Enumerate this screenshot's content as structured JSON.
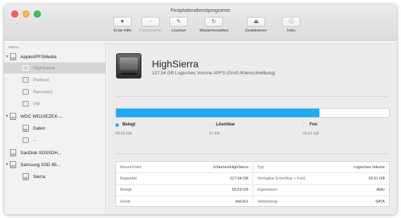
{
  "window": {
    "title": "Festplattendienstprogramm"
  },
  "toolbar": {
    "items": [
      {
        "label": "Erste Hilfe",
        "icon": "stethoscope-icon",
        "glyph": "♥",
        "enabled": true
      },
      {
        "label": "Partitionieren",
        "icon": "partition-pie-icon",
        "glyph": "◔",
        "enabled": false
      },
      {
        "label": "Löschen",
        "icon": "erase-icon",
        "glyph": "✎",
        "enabled": true
      },
      {
        "label": "Wiederherstellen",
        "icon": "restore-icon",
        "glyph": "↻",
        "enabled": true
      },
      {
        "label": "Deaktivieren",
        "icon": "eject-icon",
        "glyph": "⏏",
        "enabled": true
      },
      {
        "label": "Infos",
        "icon": "info-icon",
        "glyph": "ⓘ",
        "enabled": true
      }
    ]
  },
  "sidebar": {
    "section_header": "Intern",
    "items": [
      {
        "label": "AppleAPFSMedia",
        "type": "disk",
        "expanded": true
      },
      {
        "label": "HighSierra",
        "type": "volume",
        "selected": true
      },
      {
        "label": "Preboot",
        "type": "volume",
        "dimmed": true
      },
      {
        "label": "Recovery",
        "type": "volume",
        "dimmed": true
      },
      {
        "label": "VM",
        "type": "volume",
        "dimmed": true
      },
      {
        "label": "WDC WD10EZEX-...",
        "type": "disk",
        "expanded": true
      },
      {
        "label": "Daten",
        "type": "volume",
        "dimmed": false
      },
      {
        "label": "--",
        "type": "volume",
        "dimmed": true
      },
      {
        "label": "SanDisk SDSSDH...",
        "type": "disk",
        "expanded": false
      },
      {
        "label": "Samsung SSD 85...",
        "type": "disk",
        "expanded": true
      },
      {
        "label": "Sierra",
        "type": "volume",
        "dimmed": false
      }
    ]
  },
  "volume": {
    "name": "HighSierra",
    "description": "127,04 GB Logisches Volume APFS (Groß-/Kleinschreibung)"
  },
  "usage": {
    "used_fraction": 0.745,
    "legend": [
      {
        "label": "Belegt",
        "value": "93,53 GB",
        "color": "#1badf8"
      },
      {
        "label": "Löschbar",
        "value": "17 KB",
        "color": "#ffffff"
      },
      {
        "label": "Frei",
        "value": "33,51 GB",
        "color": "#ffffff"
      }
    ]
  },
  "info": {
    "rows": [
      [
        {
          "key": "Mount-Point:",
          "value": "/Volumes/HighSierra"
        },
        {
          "key": "Typ:",
          "value": "Logisches Volume"
        }
      ],
      [
        {
          "key": "Kapazität:",
          "value": "127,04 GB"
        },
        {
          "key": "Verfügbar (Löschbar + Frei):",
          "value": "33,51 GB"
        }
      ],
      [
        {
          "key": "Belegt:",
          "value": "93,53 GB"
        },
        {
          "key": "Eigentümer:",
          "value": "Aktiv"
        }
      ],
      [
        {
          "key": "Gerät:",
          "value": "disk3s1"
        },
        {
          "key": "Verbindung:",
          "value": "SATA"
        }
      ]
    ]
  }
}
